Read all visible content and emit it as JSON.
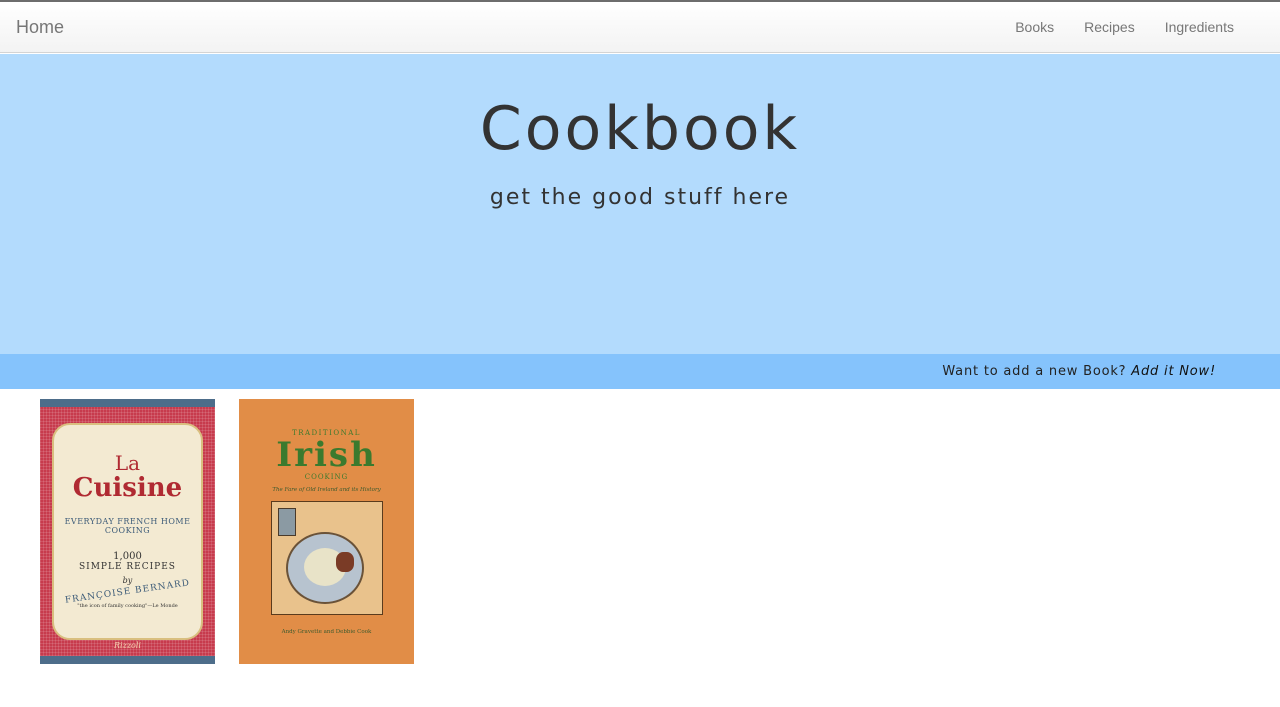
{
  "navbar": {
    "brand": "Home",
    "links": [
      "Books",
      "Recipes",
      "Ingredients"
    ]
  },
  "hero": {
    "title": "Cookbook",
    "subtitle": "get the good stuff here",
    "background": "#b3dbfd"
  },
  "add_bar": {
    "prompt": "Want to add a new Book?",
    "link": "Add it Now!",
    "background": "#85c3fc"
  },
  "books": [
    {
      "cover_title_top": "La",
      "cover_title": "Cuisine",
      "cover_subtitle": "EVERYDAY FRENCH HOME COOKING",
      "cover_count": "1,000",
      "cover_count_label": "SIMPLE RECIPES",
      "cover_by": "by",
      "cover_author": "FRANÇOISE BERNARD",
      "cover_quote": "\"the icon of family cooking\"—Le Monde",
      "cover_publisher": "Rizzoli"
    },
    {
      "cover_title_top": "TRADITIONAL",
      "cover_title": "Irish",
      "cover_subtitle": "COOKING",
      "cover_tagline": "The Fare of Old Ireland and its History",
      "cover_authors": "Andy Gravette and Debbie Cook"
    }
  ]
}
